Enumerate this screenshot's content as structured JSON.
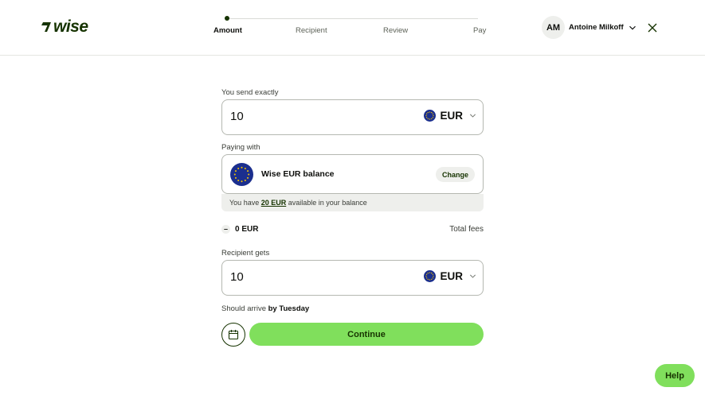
{
  "brand": {
    "name": "wise",
    "color": "#163300",
    "accent": "#80df5c"
  },
  "stepper": {
    "steps": [
      {
        "label": "Amount",
        "active": true
      },
      {
        "label": "Recipient",
        "active": false
      },
      {
        "label": "Review",
        "active": false
      },
      {
        "label": "Pay",
        "active": false
      }
    ]
  },
  "account": {
    "initials": "AM",
    "name": "Antoine Milkoff"
  },
  "send": {
    "label": "You send exactly",
    "amount": "10",
    "currency": "EUR"
  },
  "paying": {
    "label": "Paying with",
    "method": "Wise EUR balance",
    "change_label": "Change",
    "note_prefix": "You have ",
    "note_amount": "20 EUR",
    "note_suffix": " available in your balance"
  },
  "fees": {
    "symbol": "–",
    "amount": "0 EUR",
    "label": "Total fees"
  },
  "receive": {
    "label": "Recipient gets",
    "amount": "10",
    "currency": "EUR"
  },
  "arrival": {
    "prefix": "Should arrive ",
    "when": "by Tuesday"
  },
  "actions": {
    "continue_label": "Continue",
    "help_label": "Help"
  },
  "icons": {
    "logo": "wise-logo-icon",
    "close": "close-icon",
    "calendar": "calendar-icon",
    "chevron": "chevron-down-icon",
    "flag": "eu-flag-icon"
  }
}
